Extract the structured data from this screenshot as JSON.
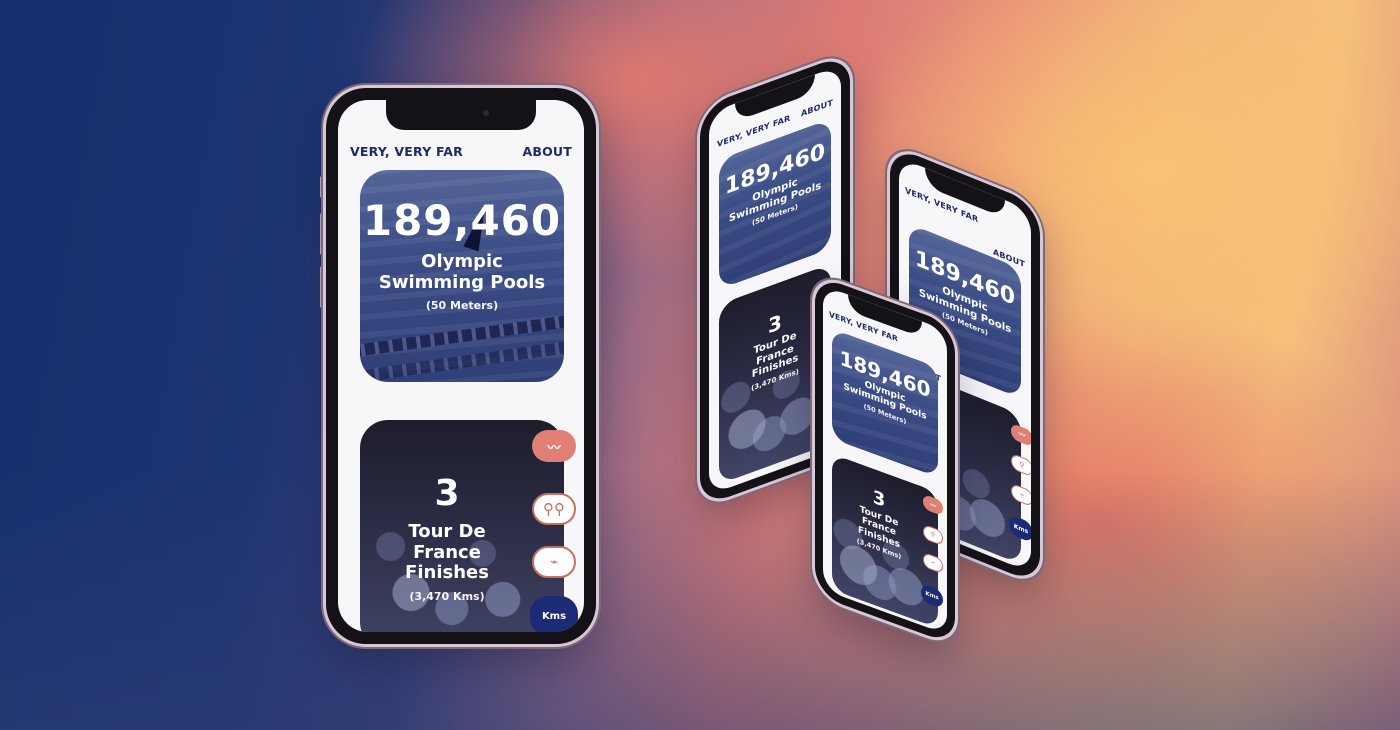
{
  "app": {
    "brand": "VERY, VERY FAR",
    "nav_about": "ABOUT"
  },
  "cards": {
    "pool": {
      "value": "189,460",
      "label_line1": "Olympic",
      "label_line2": "Swimming Pools",
      "sub": "(50 Meters)"
    },
    "tour": {
      "value": "3",
      "label_line1": "Tour De",
      "label_line2": "France",
      "label_line3": "Finishes",
      "sub": "(3,470 Kms)"
    }
  },
  "units": {
    "swim_icon": "swimmer-icon",
    "bike_icon": "bicycle-icon",
    "run_icon": "running-shoe-icon",
    "toggle_label": "Kms"
  },
  "colors": {
    "accent": "#e07f73",
    "navy": "#1b2b75",
    "text_dark": "#1f2a66"
  }
}
